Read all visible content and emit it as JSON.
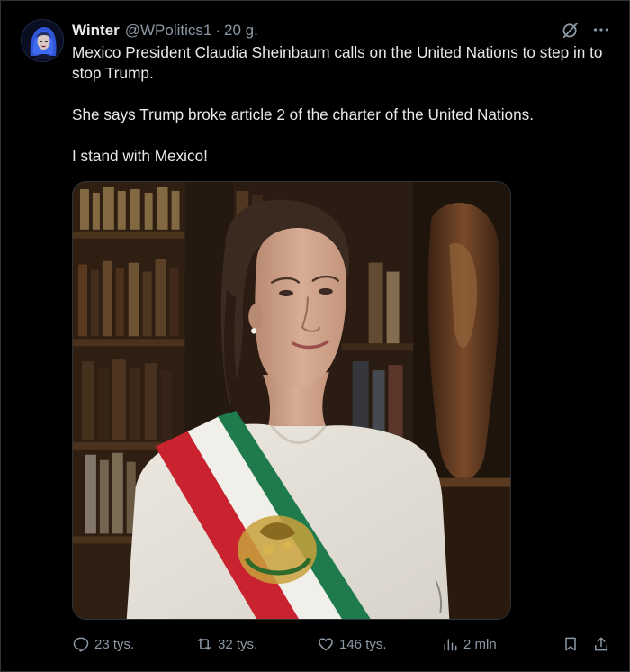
{
  "tweet": {
    "author_name": "Winter",
    "handle": "@WPolitics1",
    "separator": "·",
    "time": "20 g.",
    "paragraphs": [
      "Mexico President Claudia Sheinbaum calls on the United Nations to step in to stop Trump.",
      "She says Trump broke article 2 of the charter of the United Nations.",
      "I stand with Mexico!"
    ],
    "icons": {
      "avatar": "avatar",
      "grok": "grok-icon",
      "more": "more-icon",
      "reply": "reply-icon",
      "retweet": "retweet-icon",
      "like": "heart-icon",
      "views": "views-icon",
      "bookmark": "bookmark-icon",
      "share": "share-icon"
    }
  },
  "stats": {
    "replies": "23 tys.",
    "retweets": "32 tys.",
    "likes": "146 tys.",
    "views": "2 mln"
  },
  "colors": {
    "background": "#000000",
    "text": "#e7e9ea",
    "muted": "#8b98a5",
    "border": "#2f3336",
    "sash_green": "#1f7a4c",
    "sash_white": "#f1efe9",
    "sash_red": "#c8232e"
  }
}
